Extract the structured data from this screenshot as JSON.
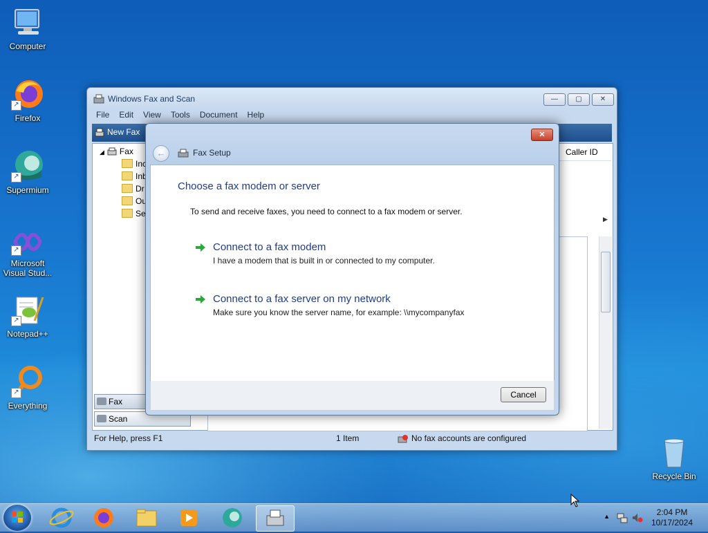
{
  "desktop": {
    "icons": [
      {
        "label": "Computer"
      },
      {
        "label": "Firefox"
      },
      {
        "label": "Supermium"
      },
      {
        "label": "Microsoft Visual Stud..."
      },
      {
        "label": "Notepad++"
      },
      {
        "label": "Everything"
      },
      {
        "label": "Recycle Bin"
      }
    ]
  },
  "window": {
    "title": "Windows Fax and Scan",
    "caption": {
      "minimize": "—",
      "maximize": "▢",
      "close": "✕"
    },
    "menu": [
      "File",
      "Edit",
      "View",
      "Tools",
      "Document",
      "Help"
    ],
    "toolbar": {
      "new_fax": "New Fax"
    },
    "tree": {
      "root": "Fax",
      "children": [
        "Inc",
        "Inb",
        "Dr",
        "Ou",
        "Se"
      ]
    },
    "nav": {
      "fax": "Fax",
      "scan": "Scan"
    },
    "columns": {
      "caller_id": "Caller ID"
    },
    "status": {
      "help": "For Help, press F1",
      "count": "1 Item",
      "accounts": "No fax accounts are configured"
    }
  },
  "dialog": {
    "title": "Fax Setup",
    "close": "✕",
    "heading": "Choose a fax modem or server",
    "intro": "To send and receive faxes, you need to connect to a fax modem or server.",
    "options": [
      {
        "title": "Connect to a fax modem",
        "desc": "I have a modem that is built in or connected to my computer."
      },
      {
        "title": "Connect to a fax server on my network",
        "desc": "Make sure you know the server name, for example: \\\\mycompanyfax"
      }
    ],
    "cancel": "Cancel"
  },
  "taskbar": {
    "time": "2:04 PM",
    "date": "10/17/2024"
  },
  "colors": {
    "accent_blue": "#1f3c8c",
    "toolbar": "#1d4f8e",
    "close_red": "#c6412a"
  }
}
